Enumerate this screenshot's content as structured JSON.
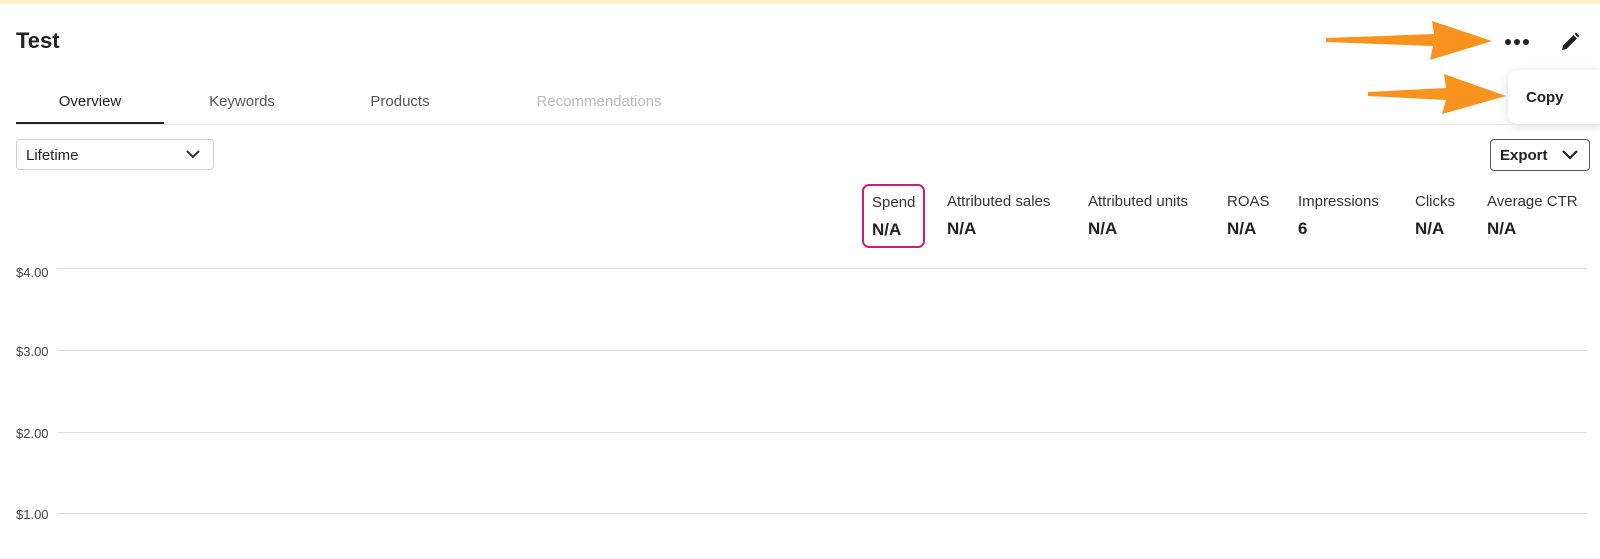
{
  "page": {
    "title": "Test"
  },
  "header": {
    "more_icon": "more-horizontal-icon",
    "edit_icon": "pencil-icon"
  },
  "copy_menu": {
    "items": [
      {
        "label": "Copy"
      }
    ]
  },
  "tabs": [
    {
      "label": "Overview",
      "state": "active"
    },
    {
      "label": "Keywords",
      "state": "normal"
    },
    {
      "label": "Products",
      "state": "normal"
    },
    {
      "label": "Recommendations",
      "state": "disabled"
    }
  ],
  "filters": {
    "range": {
      "value": "Lifetime",
      "icon": "chevron-down-icon"
    },
    "export": {
      "label": "Export",
      "icon": "chevron-down-icon"
    }
  },
  "metrics": [
    {
      "label": "Spend",
      "value": "N/A",
      "selected": true
    },
    {
      "label": "Attributed sales",
      "value": "N/A"
    },
    {
      "label": "Attributed units",
      "value": "N/A"
    },
    {
      "label": "ROAS",
      "value": "N/A"
    },
    {
      "label": "Impressions",
      "value": "6"
    },
    {
      "label": "Clicks",
      "value": "N/A"
    },
    {
      "label": "Average CTR",
      "value": "N/A"
    }
  ],
  "chart": {
    "y_ticks": [
      "$4.00",
      "$3.00",
      "$2.00",
      "$1.00"
    ]
  },
  "colors": {
    "annotation_arrow": "#f7931e",
    "selected_metric_border": "#c8207d",
    "top_banner": "#fdf1c7"
  },
  "chart_data": {
    "type": "line",
    "title": "",
    "xlabel": "",
    "ylabel": "",
    "y_tick_labels": [
      "$4.00",
      "$3.00",
      "$2.00",
      "$1.00"
    ],
    "series": [],
    "grid": true
  }
}
